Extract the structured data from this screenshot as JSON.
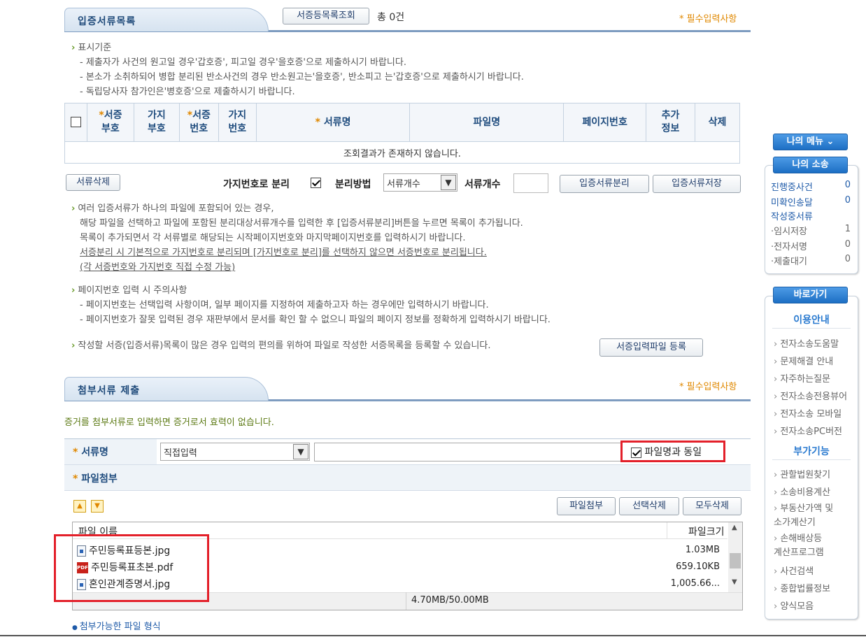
{
  "section1": {
    "tab_title": "입증서류목록",
    "lookup_button": "서증등목록조회",
    "total_label": "총 0건",
    "required_note": "* 필수입력사항"
  },
  "display_rules": {
    "heading": "표시기준",
    "lines": [
      "- 제출자가 사건의 원고일 경우'갑호증', 피고일 경우'을호증'으로 제출하시기 바랍니다.",
      "- 본소가 소취하되어 병합 분리된 반소사건의 경우 반소원고는'을호증', 반소피고 는'갑호증'으로 제출하시기 바랍니다.",
      "- 독립당사자 참가인은'병호증'으로 제출하시기 바랍니다."
    ]
  },
  "doc_table": {
    "columns": [
      {
        "label": "서증\n부호",
        "required": true
      },
      {
        "label": "가지\n부호",
        "required": false
      },
      {
        "label": "서증\n번호",
        "required": true
      },
      {
        "label": "가지\n번호",
        "required": false
      },
      {
        "label": "서류명",
        "required": true
      },
      {
        "label": "파일명",
        "required": false
      },
      {
        "label": "페이지번호",
        "required": false
      },
      {
        "label": "추가\n정보",
        "required": false
      },
      {
        "label": "삭제",
        "required": false
      }
    ],
    "empty_message": "조회결과가 존재하지 않습니다."
  },
  "controls": {
    "delete_button": "서류삭제",
    "branch_split_label": "가지번호로 분리",
    "branch_split_checked": true,
    "split_method_label": "분리방법",
    "split_method_value": "서류개수",
    "doc_count_label": "서류개수",
    "doc_count_value": "",
    "split_button": "입증서류분리",
    "save_button": "입증서류저장"
  },
  "notes1": {
    "lines": [
      "여러 입증서류가 하나의 파일에 포함되어 있는 경우,",
      "해당 파일을 선택하고 파일에 포함된 분리대상서류개수를 입력한 후 [입증서류분리]버튼을 누르면 목록이 추가됩니다.",
      "목록이 추가되면서 각 서류별로 해당되는 시작페이지번호와 마지막페이지번호를 입력하시기 바랍니다.",
      "서증분리 시 기본적으로 가지번호로 분리되며 [가지번호로 분리]를 선택하지 않으면 서증번호로 분리됩니다.",
      "(각 서증번호와 가지번호 직접 수정 가능)"
    ]
  },
  "notes2": {
    "heading": "페이지번호 입력 시 주의사항",
    "lines": [
      "- 페이지번호는 선택입력 사항이며, 일부 페이지를 지정하여 제출하고자 하는 경우에만 입력하시기 바랍니다.",
      "- 페이지번호가 잘못 입력된 경우 재판부에서 문서를 확인 할 수 없으니 파일의 페이지 정보를 정확하게 입력하시기 바랍니다."
    ]
  },
  "notes3": {
    "text": "작성할 서증(입증서류)목록이 많은 경우 입력의 편의를 위하여 파일로 작성한 서증목록을 등록할 수 있습니다.",
    "button": "서증입력파일 등록"
  },
  "section2": {
    "tab_title": "첨부서류 제출",
    "required_note": "* 필수입력사항",
    "warning": "증거를 첨부서류로 입력하면 증거로서 효력이 없습니다.",
    "doc_name_label": "서류명",
    "doc_name_select": "직접입력",
    "doc_name_input": "",
    "same_as_filename_label": "파일명과 동일",
    "same_as_filename_checked": true,
    "file_attach_label": "파일첨부",
    "attach_button": "파일첨부",
    "delete_selected_button": "선택삭제",
    "delete_all_button": "모두삭제"
  },
  "file_list": {
    "header_name": "파일 이름",
    "header_size": "파일크기",
    "files": [
      {
        "name": "주민등록표등본.jpg",
        "size": "1.03MB",
        "type": "jpg"
      },
      {
        "name": "주민등록표초본.pdf",
        "size": "659.10KB",
        "type": "pdf"
      },
      {
        "name": "혼인관계증명서.jpg",
        "size": "1,005.66...",
        "type": "jpg"
      }
    ],
    "total": "4.70MB/50.00MB"
  },
  "footer_link": "첨부가능한 파일 형식",
  "sidebar": {
    "my_menu": "나의 메뉴",
    "my_case": "나의 소송",
    "case_items": [
      {
        "label": "진행중사건",
        "value": "0",
        "highlight": true
      },
      {
        "label": "미확인송달",
        "value": "0",
        "highlight": true
      },
      {
        "label": "작성중서류",
        "value": "",
        "highlight": true
      },
      {
        "label": "·임시저장",
        "value": "1",
        "highlight": false
      },
      {
        "label": "·전자서명",
        "value": "0",
        "highlight": false
      },
      {
        "label": "·제출대기",
        "value": "0",
        "highlight": false
      }
    ],
    "shortcut": "바로가기",
    "guide_title": "이용안내",
    "guide_links": [
      "전자소송도움말",
      "문제해결 안내",
      "자주하는질문",
      "전자소송전용뷰어",
      "전자소송 모바일",
      "전자소송PC버전"
    ],
    "extra_title": "부가기능",
    "extra_links": [
      "관할법원찾기",
      "소송비용계산",
      "부동산가액 및\n소가계산기",
      "손해배상등\n계산프로그램",
      "사건검색",
      "종합법률정보",
      "양식모음"
    ]
  }
}
